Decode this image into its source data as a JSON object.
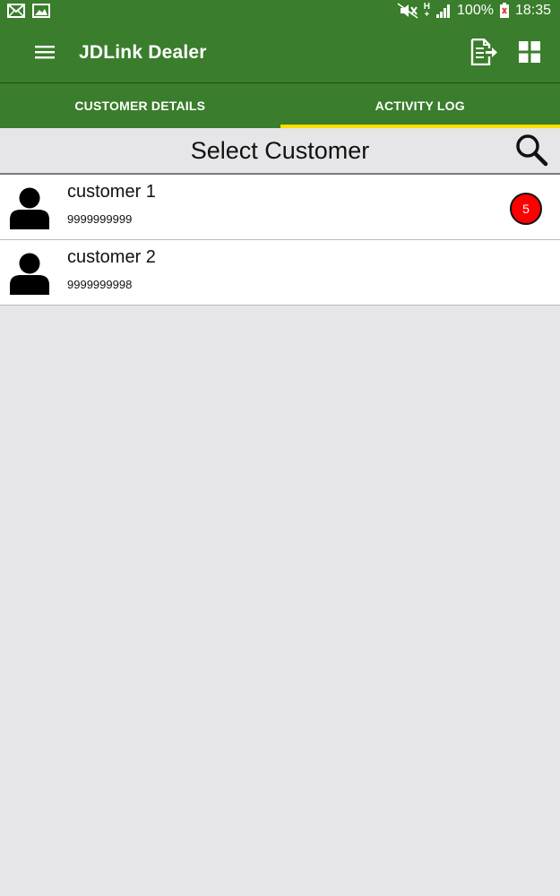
{
  "status_bar": {
    "battery": "100%",
    "time": "18:35",
    "network": "H+",
    "icons": [
      "mail-icon",
      "image-icon",
      "mute-icon",
      "signal-icon",
      "battery-icon"
    ]
  },
  "app_bar": {
    "title": "JDLink Dealer",
    "icons": [
      "menu-icon",
      "export-icon",
      "grid-icon"
    ]
  },
  "tabs": [
    {
      "label": "CUSTOMER DETAILS",
      "selected": false
    },
    {
      "label": "ACTIVITY LOG",
      "selected": true
    }
  ],
  "header": {
    "title": "Select Customer",
    "icon": "search-icon"
  },
  "customers": [
    {
      "name": "customer 1",
      "phone": "9999999999",
      "badge": "5"
    },
    {
      "name": "customer 2",
      "phone": "9999999998"
    }
  ],
  "colors": {
    "primary": "#3a7d2c",
    "tab_indicator": "#ffde00",
    "badge": "#ff0000",
    "background": "#e6e5e8"
  }
}
